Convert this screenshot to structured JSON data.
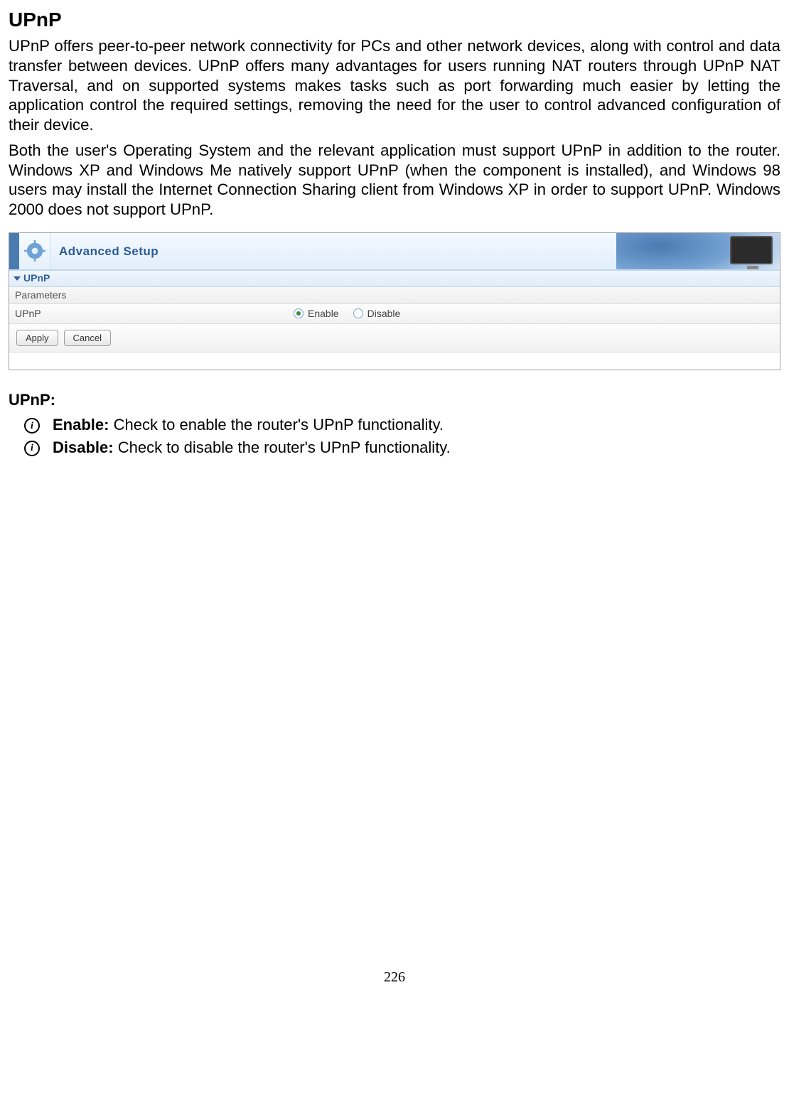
{
  "title": "UPnP",
  "para1": "UPnP offers peer-to-peer network connectivity for PCs and other network devices, along with control and data transfer between devices. UPnP offers many advantages for users running NAT routers through UPnP NAT Traversal, and on supported systems makes tasks such as port forwarding much easier by letting the application control the required settings, removing the need for the user to control advanced configuration of their device.",
  "para2": "Both the user's Operating System and the relevant application must support UPnP in addition to the router. Windows XP and Windows Me natively support UPnP (when the component is installed), and Windows 98 users may install the Internet Connection Sharing client from Windows XP in order to support UPnP. Windows 2000 does not support UPnP.",
  "screenshot": {
    "header_title": "Advanced Setup",
    "section": "UPnP",
    "parameters_label": "Parameters",
    "row_label": "UPnP",
    "enable_label": "Enable",
    "disable_label": "Disable",
    "apply_label": "Apply",
    "cancel_label": "Cancel"
  },
  "subhead": "UPnP:",
  "bullets": [
    {
      "bold": "Enable:",
      "rest": " Check to enable the router's UPnP functionality."
    },
    {
      "bold": "Disable:",
      "rest": " Check to disable the router's UPnP functionality."
    }
  ],
  "page_number": "226"
}
